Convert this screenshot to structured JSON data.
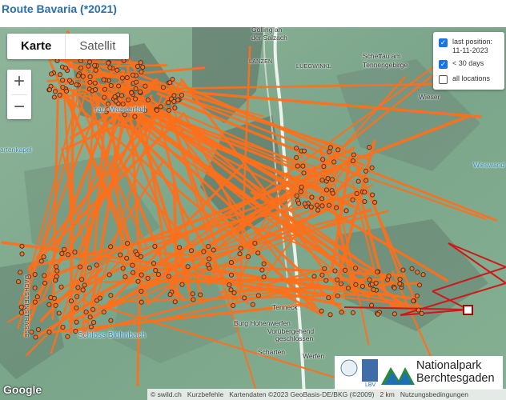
{
  "page": {
    "title": "Route Bavaria (*2021)"
  },
  "map_controls": {
    "map_type": [
      "Karte",
      "Satellit"
    ],
    "zoom_in": "+",
    "zoom_out": "−"
  },
  "legend": {
    "last_position_label": "last position:",
    "last_position_date": "11-11-2023",
    "recent_label": "< 30 days",
    "all_label": "all locations",
    "checked": [
      true,
      true,
      false
    ]
  },
  "places": {
    "golling": "Golling an",
    "der_salzach": "der Salzach",
    "lanzen": "LANZEN",
    "luegwinkl": "LUEGWINKL",
    "scheffau": "Scheffau am",
    "tennengebirge": "Tennengebirge",
    "wieser": "Wieser",
    "wasserfall": "rau Wasserfall",
    "gartenkapelle": "artenkapel",
    "wieswand": "Wieswand",
    "tenneck": "Tenneck",
    "burg": "Burg Hohenwerfen",
    "kurz": "Vorübergehend",
    "geschlossen": "geschlossen",
    "scharten": "Scharten",
    "werfen": "Werfen",
    "bluehnbach": "Schloss Blühnbach",
    "road_vertical": "DACHSTEINSTRASSE"
  },
  "icons": [
    "plus-icon",
    "minus-icon",
    "checkbox-icon",
    "marker-icon",
    "mountain-logo"
  ],
  "logos": {
    "nationalpark_line1": "Nationalpark",
    "nationalpark_line2": "Berchtesgaden",
    "lbv": "LBV"
  },
  "attribution": {
    "google": "Google",
    "swild": "© swild.ch",
    "kurzbefehle": "Kurzbefehle",
    "kartendaten": "Kartendaten ©2023 GeoBasis-DE/BKG (©2009)",
    "scale": "2 km",
    "nutzung": "Nutzungsbedingungen"
  },
  "colors": {
    "track": "#ff6f1a",
    "recent_track": "#cc1a1a",
    "point_fill": "#ff6f1a",
    "point_stroke": "#333333",
    "accent": "#1a73e8",
    "title": "#2a6fa8"
  }
}
